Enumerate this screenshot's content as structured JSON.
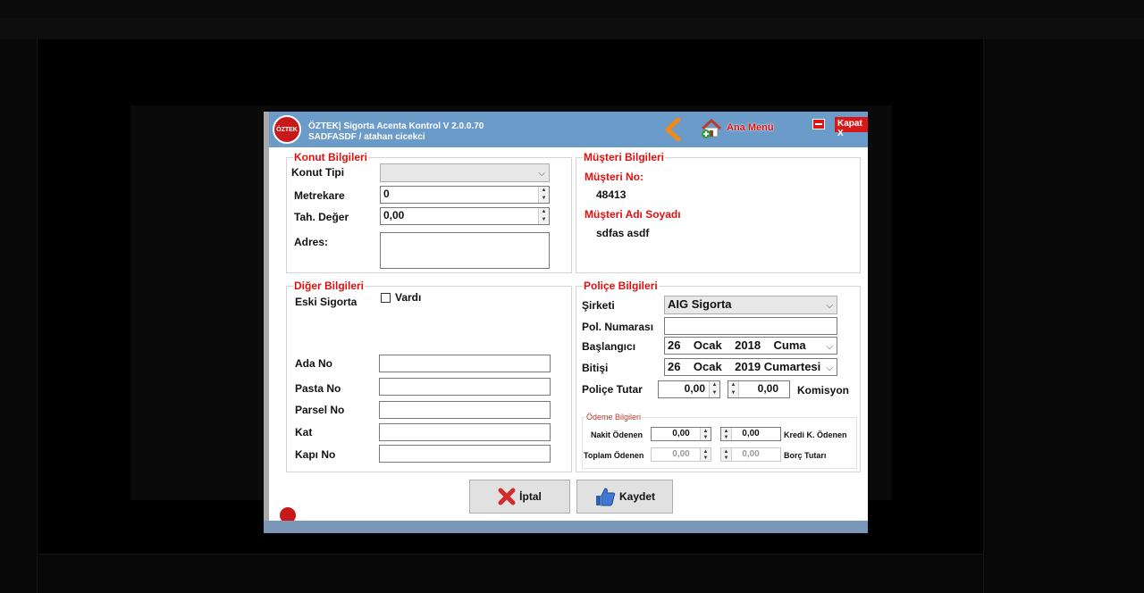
{
  "window": {
    "title": "ÖZTEK| Sigorta Acenta Kontrol V 2.0.0.70",
    "subtitle": "SADFASDF / atahan cicekci",
    "home_label": "Ana Menü",
    "close_label": "Kapat X"
  },
  "konut": {
    "title": "Konut Bilgileri",
    "tip_label": "Konut Tipi",
    "tip_value": "",
    "metrekare_label": "Metrekare",
    "metrekare_value": "0",
    "deger_label": "Tah. Değer",
    "deger_value": "0,00",
    "adres_label": "Adres:",
    "adres_value": ""
  },
  "musteri": {
    "title": "Müşteri Bilgileri",
    "no_label": "Müşteri No:",
    "no_value": "48413",
    "ad_label": "Müşteri Adı Soyadı",
    "ad_value": "sdfas asdf"
  },
  "diger": {
    "title": "Diğer Bilgileri",
    "eski_label": "Eski Sigorta",
    "vardi_label": "Vardı",
    "vardi_checked": false,
    "ada_label": "Ada No",
    "pasta_label": "Pasta No",
    "parsel_label": "Parsel No",
    "kat_label": "Kat",
    "kapi_label": "Kapı No"
  },
  "police": {
    "title": "Poliçe Bilgileri",
    "sirket_label": "Şirketi",
    "sirket_value": "AIG Sigorta",
    "numara_label": "Pol. Numarası",
    "numara_value": "",
    "baslangic_label": "Başlangıcı",
    "baslangic_value": "26    Ocak    2018    Cuma",
    "bitis_label": "Bitişi",
    "bitis_value": "26    Ocak    2019 Cumartesi",
    "tutar_label": "Poliçe Tutar",
    "tutar_value": "0,00",
    "komisyon_value": "0,00",
    "komisyon_label": "Komisyon"
  },
  "odeme": {
    "title": "Ödeme Bilgileri",
    "nakit_label": "Nakit Ödenen",
    "nakit_value": "0,00",
    "kredi_value": "0,00",
    "kredi_label": "Kredi K. Ödenen",
    "toplam_label": "Toplam Ödenen",
    "toplam_value": "0,00",
    "borc_value": "0,00",
    "borc_label": "Borç Tutarı"
  },
  "buttons": {
    "cancel_label": "İptal",
    "save_label": "Kaydet"
  },
  "colors": {
    "titlebar": "#6b9bc9",
    "accent_red": "#e01010"
  },
  "icons": {
    "back": "chevron-left-icon",
    "home": "home-icon",
    "cancel": "x-mark-icon",
    "save": "thumbs-up-icon"
  }
}
